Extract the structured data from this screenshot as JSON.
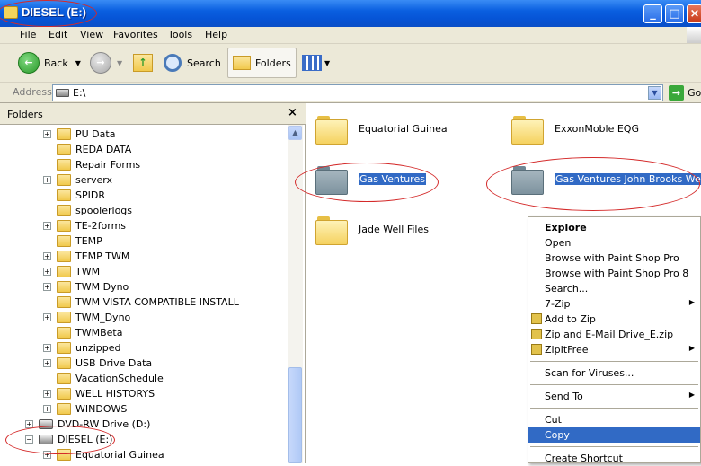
{
  "window": {
    "title": "DIESEL (E:)",
    "controls": [
      "minimize",
      "maximize",
      "close"
    ]
  },
  "menubar": {
    "items": [
      "File",
      "Edit",
      "View",
      "Favorites",
      "Tools",
      "Help"
    ]
  },
  "toolbar": {
    "back_label": "Back",
    "search_label": "Search",
    "folders_label": "Folders"
  },
  "addressbar": {
    "label": "Address",
    "value": "E:\\",
    "go_label": "Go"
  },
  "folders_pane": {
    "title": "Folders",
    "tree": [
      {
        "label": "PU Data",
        "expandable": true,
        "type": "folder",
        "indent": 3
      },
      {
        "label": "REDA DATA",
        "expandable": false,
        "type": "folder",
        "indent": 3
      },
      {
        "label": "Repair Forms",
        "expandable": false,
        "type": "folder",
        "indent": 3
      },
      {
        "label": "serverx",
        "expandable": true,
        "type": "folder",
        "indent": 3
      },
      {
        "label": "SPIDR",
        "expandable": false,
        "type": "folder",
        "indent": 3
      },
      {
        "label": "spoolerlogs",
        "expandable": false,
        "type": "folder",
        "indent": 3
      },
      {
        "label": "TE-2forms",
        "expandable": true,
        "type": "folder",
        "indent": 3
      },
      {
        "label": "TEMP",
        "expandable": false,
        "type": "folder",
        "indent": 3
      },
      {
        "label": "TEMP TWM",
        "expandable": true,
        "type": "folder",
        "indent": 3
      },
      {
        "label": "TWM",
        "expandable": true,
        "type": "folder",
        "indent": 3
      },
      {
        "label": "TWM Dyno",
        "expandable": true,
        "type": "folder",
        "indent": 3
      },
      {
        "label": "TWM VISTA COMPATIBLE INSTALL",
        "expandable": false,
        "type": "folder",
        "indent": 3
      },
      {
        "label": "TWM_Dyno",
        "expandable": true,
        "type": "folder",
        "indent": 3
      },
      {
        "label": "TWMBeta",
        "expandable": false,
        "type": "folder",
        "indent": 3
      },
      {
        "label": "unzipped",
        "expandable": true,
        "type": "folder",
        "indent": 3
      },
      {
        "label": "USB Drive Data",
        "expandable": true,
        "type": "folder",
        "indent": 3
      },
      {
        "label": "VacationSchedule",
        "expandable": false,
        "type": "folder",
        "indent": 3
      },
      {
        "label": "WELL HISTORYS",
        "expandable": true,
        "type": "folder",
        "indent": 3
      },
      {
        "label": "WINDOWS",
        "expandable": true,
        "type": "folder",
        "indent": 3
      },
      {
        "label": "DVD-RW Drive (D:)",
        "expandable": true,
        "type": "drive",
        "indent": 2
      },
      {
        "label": "DIESEL (E:)",
        "expandable": true,
        "expanded": true,
        "type": "drive",
        "indent": 2
      },
      {
        "label": "Equatorial Guinea",
        "expandable": true,
        "type": "folder",
        "indent": 3
      }
    ]
  },
  "content": {
    "items": [
      {
        "name": "Equatorial Guinea",
        "selected": false
      },
      {
        "name": "ExxonMoble EQG",
        "selected": false
      },
      {
        "name": "Gas Ventures",
        "selected": true
      },
      {
        "name": "Gas Ventures John Brooks Wells",
        "selected": true
      },
      {
        "name": "Jade Well Files",
        "selected": false
      }
    ]
  },
  "context_menu": {
    "items": [
      {
        "label": "Explore",
        "bold": true
      },
      {
        "label": "Open"
      },
      {
        "label": "Browse with Paint Shop Pro"
      },
      {
        "label": "Browse with Paint Shop Pro 8"
      },
      {
        "label": "Search..."
      },
      {
        "label": "7-Zip",
        "submenu": true
      },
      {
        "label": "Add to Zip",
        "icon": true
      },
      {
        "label": "Zip and E-Mail Drive_E.zip",
        "icon": true
      },
      {
        "label": "ZipItFree",
        "submenu": true,
        "icon": true
      },
      {
        "separator": true
      },
      {
        "label": "Scan for Viruses..."
      },
      {
        "separator": true
      },
      {
        "label": "Send To",
        "submenu": true
      },
      {
        "separator": true
      },
      {
        "label": "Cut"
      },
      {
        "label": "Copy",
        "highlighted": true
      },
      {
        "separator": true
      },
      {
        "label": "Create Shortcut"
      }
    ]
  }
}
